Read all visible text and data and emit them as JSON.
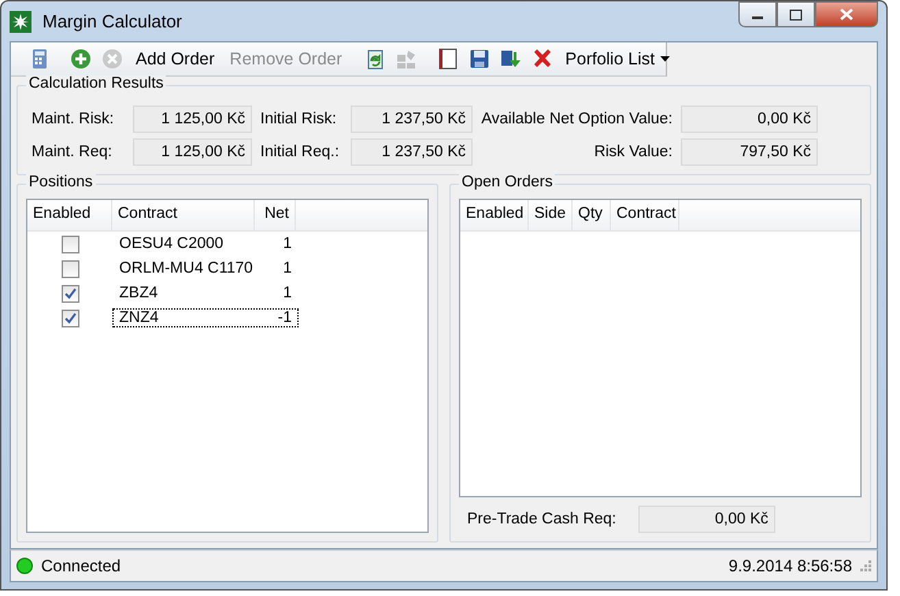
{
  "window": {
    "title": "Margin Calculator"
  },
  "toolbar": [
    {
      "kind": "icon",
      "disabled": false
    },
    {
      "kind": "icon",
      "disabled": false
    },
    {
      "kind": "icon",
      "disabled": true
    },
    {
      "kind": "text",
      "label": "Add Order",
      "disabled": false
    },
    {
      "kind": "text",
      "label": "Remove Order",
      "disabled": true
    },
    {
      "kind": "icon",
      "disabled": false
    },
    {
      "kind": "icon",
      "disabled": true
    },
    {
      "kind": "icon",
      "disabled": false
    },
    {
      "kind": "icon",
      "disabled": false
    },
    {
      "kind": "icon",
      "disabled": false
    },
    {
      "kind": "icon",
      "disabled": false
    },
    {
      "kind": "menu",
      "label": "Porfolio List",
      "disabled": false
    }
  ],
  "calculation_results": {
    "title": "Calculation Results",
    "fields": [
      {
        "label": "Maint. Risk:",
        "value": "1 125,00 Kč"
      },
      {
        "label": "Initial Risk:",
        "value": "1 237,50 Kč"
      },
      {
        "label": "Available Net Option Value:",
        "value": "0,00 Kč"
      },
      {
        "label": "Maint. Req:",
        "value": "1 125,00 Kč"
      },
      {
        "label": "Initial Req.:",
        "value": "1 237,50 Kč"
      },
      {
        "label": "Risk Value:",
        "value": "797,50 Kč"
      }
    ]
  },
  "positions": {
    "title": "Positions",
    "columns": [
      "Enabled",
      "Contract",
      "Net"
    ],
    "rows": [
      {
        "enabled": false,
        "contract": "OESU4 C2000",
        "net": "1",
        "focused": false
      },
      {
        "enabled": false,
        "contract": "ORLM-MU4 C1170",
        "net": "1",
        "focused": false
      },
      {
        "enabled": true,
        "contract": "ZBZ4",
        "net": "1",
        "focused": false
      },
      {
        "enabled": true,
        "contract": "ZNZ4",
        "net": "-1",
        "focused": true
      }
    ]
  },
  "open_orders": {
    "title": "Open Orders",
    "columns": [
      "Enabled",
      "Side",
      "Qty",
      "Contract"
    ],
    "pre_trade_label": "Pre-Trade Cash Req:",
    "pre_trade_value": "0,00 Kč"
  },
  "status_bar": {
    "connected": true,
    "status": "Connected",
    "timestamp": "9.9.2014 8:56:58"
  }
}
